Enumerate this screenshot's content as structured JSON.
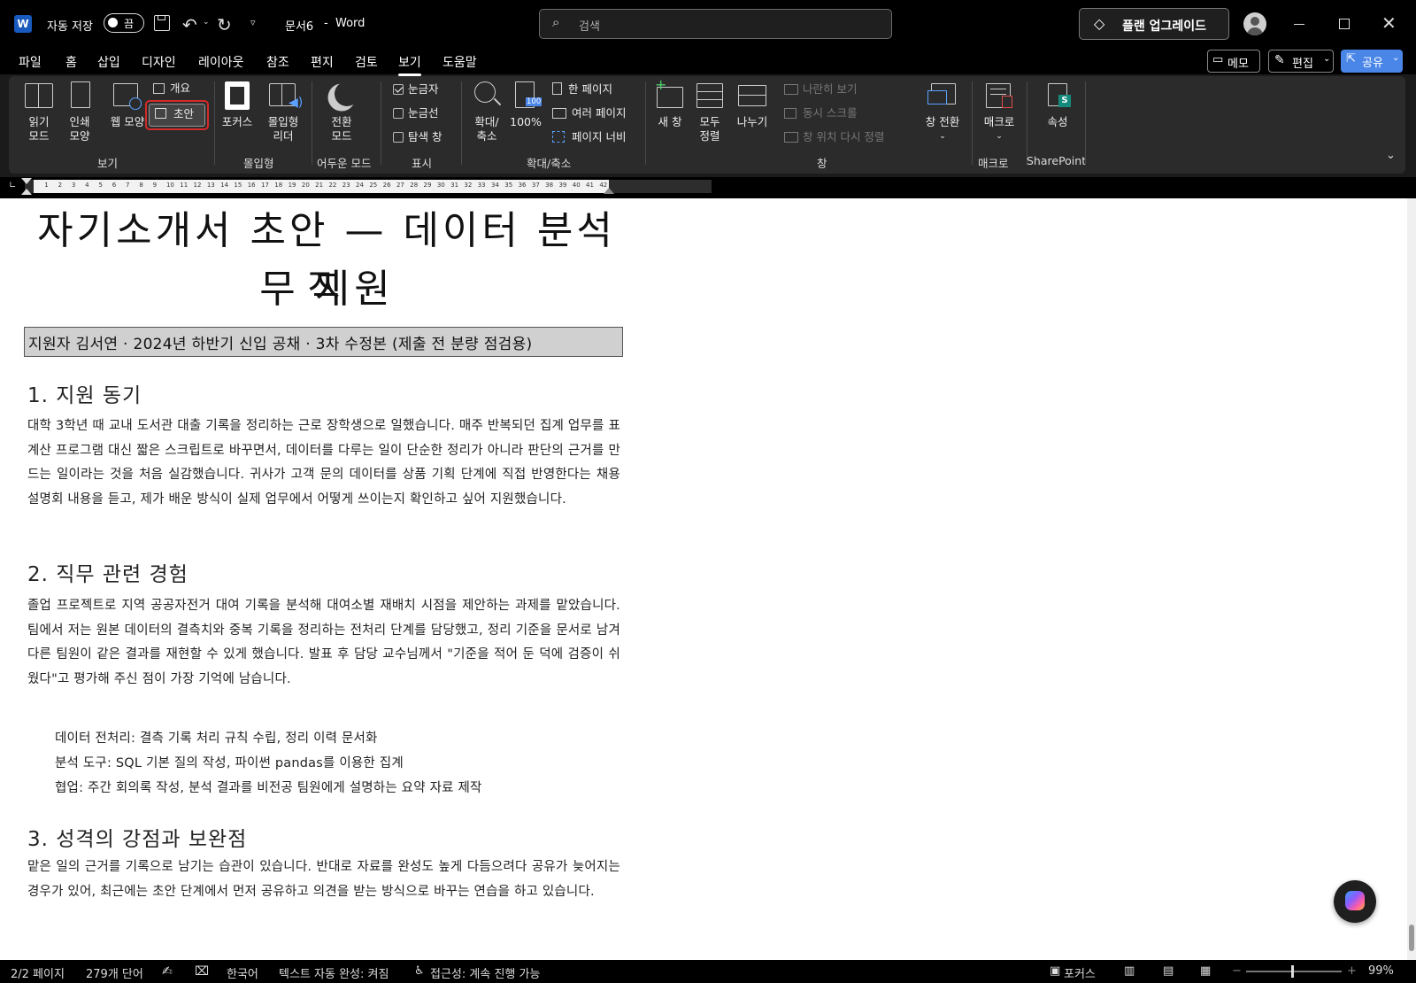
{
  "titlebar": {
    "autosave_label": "자동 저장",
    "autosave_state": "끔",
    "doc_name": "문서6",
    "separator": "-",
    "app_name": "Word",
    "search_placeholder": "검색",
    "upgrade_label": "플랜 업그레이드"
  },
  "menu": {
    "items": [
      "파일",
      "홈",
      "삽입",
      "디자인",
      "레이아웃",
      "참조",
      "편지",
      "검토",
      "보기",
      "도움말"
    ],
    "active": "보기",
    "memo_label": "메모",
    "edit_label": "편집",
    "share_label": "공유"
  },
  "ribbon": {
    "view": {
      "read_mode": [
        "읽기",
        "모드"
      ],
      "print_layout": [
        "인쇄",
        "모양"
      ],
      "web_layout": "웹 모양",
      "outline": "개요",
      "draft": "초안",
      "group": "보기"
    },
    "immersive": {
      "focus": "포커스",
      "reader": [
        "몰입형",
        "리더"
      ],
      "group": "몰입형"
    },
    "dark": {
      "switch": [
        "전환",
        "모드"
      ],
      "group": "어두운 모드"
    },
    "show": {
      "ruler": "눈금자",
      "gridlines": "눈금선",
      "navpane": "탐색 창",
      "group": "표시"
    },
    "zoom": {
      "zoom": [
        "확대/",
        "축소"
      ],
      "hundred": "100%",
      "hundred_badge": "100",
      "one_page": "한 페이지",
      "multi_page": "여러 페이지",
      "page_width": "페이지 너비",
      "group": "확대/축소"
    },
    "window": {
      "new_window": "새 창",
      "arrange_all": [
        "모두",
        "정렬"
      ],
      "split": "나누기",
      "side_by_side": "나란히 보기",
      "sync_scroll": "동시 스크롤",
      "reset_position": "창 위치 다시 정렬",
      "switch_windows": "창 전환",
      "group": "창"
    },
    "macros": {
      "macros": "매크로",
      "group": "매크로"
    },
    "sharepoint": {
      "properties": "속성",
      "badge": "S",
      "group": "SharePoint"
    }
  },
  "ruler": {
    "ticks": [
      "1",
      "2",
      "3",
      "4",
      "5",
      "6",
      "7",
      "8",
      "9",
      "10",
      "11",
      "12",
      "13",
      "14",
      "15",
      "16",
      "17",
      "18",
      "19",
      "20",
      "21",
      "22",
      "23",
      "24",
      "25",
      "26",
      "27",
      "28",
      "29",
      "30",
      "31",
      "32",
      "33",
      "34",
      "35",
      "36",
      "37",
      "38",
      "39",
      "40",
      "41",
      "42"
    ]
  },
  "document": {
    "title_line1": "자기소개서 초안 — 데이터 분석 직",
    "title_line2": "무 지원",
    "subtitle": "지원자 김서연 · 2024년 하반기 신입 공채 · 3차 수정본 (제출 전 분량 점검용)",
    "h1": "1. 지원 동기",
    "p1": "대학 3학년 때 교내 도서관 대출 기록을 정리하는 근로 장학생으로 일했습니다. 매주 반복되던 집계 업무를 표 계산 프로그램 대신 짧은 스크립트로 바꾸면서, 데이터를 다루는 일이 단순한 정리가 아니라 판단의 근거를 만드는 일이라는 것을 처음 실감했습니다. 귀사가 고객 문의 데이터를 상품 기획 단계에 직접 반영한다는 채용 설명회 내용을 듣고, 제가 배운 방식이 실제 업무에서 어떻게 쓰이는지 확인하고 싶어 지원했습니다.",
    "h2": "2. 직무 관련 경험",
    "p2": "졸업 프로젝트로 지역 공공자전거 대여 기록을 분석해 대여소별 재배치 시점을 제안하는 과제를 맡았습니다. 팀에서 저는 원본 데이터의 결측치와 중복 기록을 정리하는 전처리 단계를 담당했고, 정리 기준을 문서로 남겨 다른 팀원이 같은 결과를 재현할 수 있게 했습니다. 발표 후 담당 교수님께서 \"기준을 적어 둔 덕에 검증이 쉬웠다\"고 평가해 주신 점이 가장 기억에 남습니다.",
    "bullets": [
      "데이터 전처리: 결측 기록 처리 규칙 수립, 정리 이력 문서화",
      "분석 도구: SQL 기본 질의 작성, 파이썬 pandas를 이용한 집계",
      "협업: 주간 회의록 작성, 분석 결과를 비전공 팀원에게 설명하는 요약 자료 제작"
    ],
    "h3": "3. 성격의 강점과 보완점",
    "p3": "맡은 일의 근거를 기록으로 남기는 습관이 있습니다. 반대로 자료를 완성도 높게 다듬으려다 공유가 늦어지는 경우가 있어, 최근에는 초안 단계에서 먼저 공유하고 의견을 받는 방식으로 바꾸는 연습을 하고 있습니다."
  },
  "status": {
    "page": "2/2 페이지",
    "words": "279개 단어",
    "language": "한국어",
    "autocomplete": "텍스트 자동 완성: 켜짐",
    "accessibility": "접근성: 계속 진행 가능",
    "focus": "포커스",
    "zoom": "99%"
  },
  "colors": {
    "highlight_box": "#d42b2b",
    "share_button": "#4a86e8",
    "word_blue": "#185abd",
    "copilot": "#1f1f1f"
  }
}
